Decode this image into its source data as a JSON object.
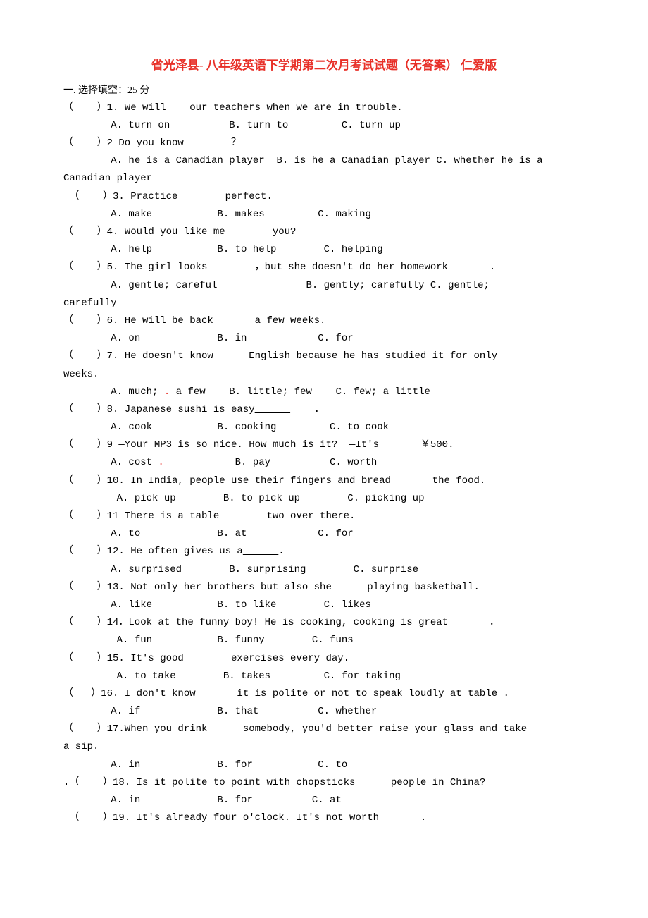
{
  "title": "省光泽县-  八年级英语下学期第二次月考试试题（无答案） 仁爱版",
  "section_header": "一. 选择填空：25 分",
  "questions": [
    {
      "q": "（    ）1. We will    our teachers when we are in trouble.",
      "opts": "        A. turn on          B. turn to         C. turn up"
    },
    {
      "q": "（    ）2 Do you know        ？",
      "opts": "        A. he is a Canadian player  B. is he a Canadian player C. whether he is a",
      "cont": "Canadian player"
    },
    {
      "q": " （    ）3. Practice        perfect.",
      "opts": "        A. make           B. makes         C. making"
    },
    {
      "q": "（    ）4. Would you like me        you?",
      "opts": "        A. help           B. to help        C. helping"
    },
    {
      "q": "（    ）5. The girl looks        ，but she doesn't do her homework       .",
      "opts": "        A. gentle; careful               B. gently; carefully C. gentle;",
      "cont": "carefully"
    },
    {
      "q": "（    ）6. He will be back       a few weeks.",
      "opts": "        A. on             B. in            C. for"
    },
    {
      "q": "（    ）7. He doesn't know      English because he has studied it for only",
      "cont_before": "weeks.",
      "opts": "        A. much; a few    B. little; few    C. few; a little",
      "dot_after_a": true
    },
    {
      "q": "（    ）8. Japanese sushi is easy          .",
      "opts": "        A. cook           B. cooking         C. to cook",
      "underline_blank": true
    },
    {
      "q": "（    ）9 —Your MP3 is so nice. How much is it?  —It's       ￥500.",
      "opts": "        A. cost            B. pay          C. worth",
      "dot_after_a": true
    },
    {
      "q": "（    ）10. In India, people use their fingers and bread       the food.",
      "opts": "         A. pick up        B. to pick up        C. picking up"
    },
    {
      "q": "（    ）11 There is a table        two over there.",
      "opts": "        A. to             B. at            C. for"
    },
    {
      "q": "（    ）12. He often gives us a      .",
      "opts": "        A. surprised        B. surprising        C. surprise",
      "underline_blank": true
    },
    {
      "q": "（    ）13. Not only her brothers but also she      playing basketball.",
      "opts": "        A. like           B. to like        C. likes"
    },
    {
      "q": "（    ）14．Look at the funny boy! He is cooking, cooking is great       ．",
      "opts": "         A. fun           B. funny        C. funs"
    },
    {
      "q": "（    ）15. It's good        exercises every day.",
      "opts": "         A. to take        B. takes         C. for taking"
    },
    {
      "q": "（   ）16. I don't know       it is polite or not to speak loudly at table .",
      "opts": "        A. if             B. that          C. whether"
    },
    {
      "q": "（    ）17.When you drink      somebody, you'd better raise your glass and take",
      "cont_before": "a sip.",
      "opts": "        A. in             B. for           C. to"
    },
    {
      "q": ".（    ）18. Is it polite to point with chopsticks      people in China?",
      "opts": "        A. in             B. for          C. at"
    },
    {
      "q": " （    ）19. It's already four o'clock. It's not worth       .",
      "opts": ""
    }
  ]
}
